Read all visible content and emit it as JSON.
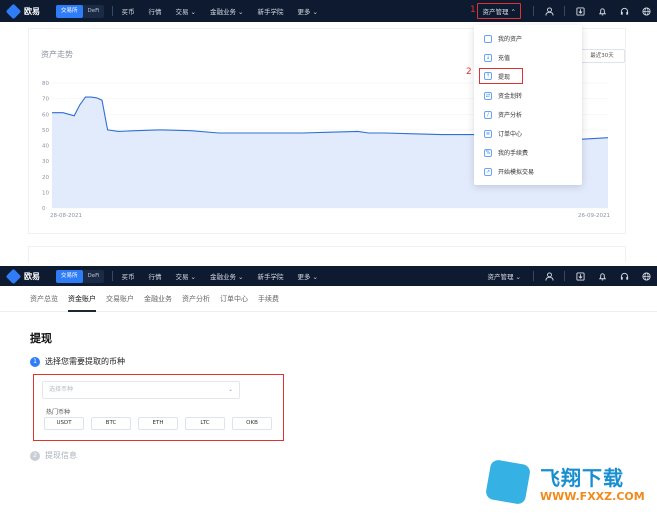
{
  "nav": {
    "logo": "欧易",
    "pill": [
      "交易所",
      "DeFi"
    ],
    "items": [
      "买币",
      "行情",
      "交易 ⌄",
      "金融业务 ⌄",
      "新手学院",
      "更多 ⌄"
    ],
    "asset_manage": "资产管理 ⌃",
    "asset_manage_bottom": "资产管理 ⌄"
  },
  "markers": {
    "one": "1",
    "two": "2"
  },
  "chart": {
    "title": "资产走势",
    "range_button": "最近30天"
  },
  "chart_data": {
    "type": "area",
    "title": "资产走势",
    "xlabel": "",
    "ylabel": "",
    "ylim": [
      0,
      80
    ],
    "yticks": [
      "0",
      "10",
      "20",
      "30",
      "40",
      "50",
      "60",
      "70",
      "80"
    ],
    "x_tick_labels": [
      "28-08-2021",
      "26-09-2021"
    ],
    "x": [
      0,
      2,
      4,
      5,
      6,
      7,
      8,
      9,
      10,
      12,
      15,
      19,
      20,
      25,
      30,
      35,
      40,
      45,
      50,
      55,
      57,
      60,
      65,
      70,
      75,
      80,
      85,
      90,
      95,
      100
    ],
    "values": [
      61,
      61,
      59,
      66,
      71,
      71,
      70.5,
      69,
      50,
      49,
      49.5,
      50,
      50,
      49.5,
      48,
      48,
      48,
      48,
      48.5,
      49,
      48,
      48,
      47.5,
      47,
      47,
      47,
      46,
      45,
      44,
      45
    ],
    "series": [
      {
        "values": [
          61,
          61,
          59,
          66,
          71,
          71,
          70.5,
          69,
          50,
          49,
          49.5,
          50,
          50,
          49.5,
          48,
          48,
          48,
          48,
          48.5,
          49,
          48,
          48,
          47.5,
          47,
          47,
          47,
          46,
          45,
          44,
          45
        ]
      }
    ],
    "grid": true,
    "colors": {
      "line": "#2f6fd6",
      "fill": "#dde7fb"
    }
  },
  "dropdown": {
    "items": [
      {
        "label": "我的资产",
        "icon": "wallet-icon"
      },
      {
        "label": "充值",
        "icon": "deposit-icon"
      },
      {
        "label": "提现",
        "icon": "withdraw-icon"
      },
      {
        "label": "资金划转",
        "icon": "transfer-icon"
      },
      {
        "label": "资产分析",
        "icon": "analysis-icon"
      },
      {
        "label": "订单中心",
        "icon": "order-icon"
      },
      {
        "label": "我的手续费",
        "icon": "fee-icon"
      },
      {
        "label": "开始模拟交易",
        "icon": "demo-trade-icon"
      }
    ]
  },
  "subnav": {
    "tabs": [
      "资产总览",
      "资金账户",
      "交易账户",
      "金融业务",
      "资产分析",
      "订单中心",
      "手续费"
    ]
  },
  "page": {
    "title": "提现",
    "step1_num": "1",
    "step1_label": "选择您需要提取的币种",
    "select_placeholder": "选择币种",
    "hot_label": "热门币种",
    "coins": [
      "USDT",
      "BTC",
      "ETH",
      "LTC",
      "OKB"
    ],
    "step2_num": "2",
    "step2_label": "提现信息"
  },
  "watermark": {
    "title": "飞翔下载",
    "url": "WWW.FXXZ.COM"
  },
  "colors": {
    "nav_bg": "#0d1a30",
    "accent": "#2f7df6",
    "highlight": "#e0322f"
  }
}
